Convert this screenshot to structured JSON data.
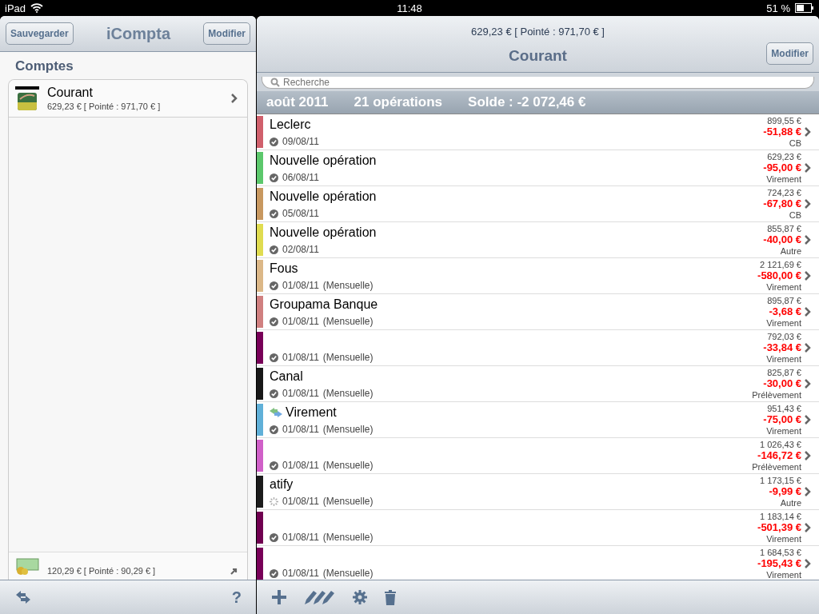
{
  "status_bar": {
    "device": "iPad",
    "time": "11:48",
    "battery": "51 %"
  },
  "left": {
    "save_button": "Sauvegarder",
    "title": "iCompta",
    "edit_button": "Modifier",
    "section": "Comptes",
    "accounts": [
      {
        "name": "Courant",
        "balance": "629,23 € [ Pointé : 971,70 € ]",
        "kind": "bank"
      },
      {
        "balance": "120,29 € [ Pointé : 90,29 € ]",
        "kind": "cash"
      }
    ],
    "help": "?"
  },
  "right": {
    "subtitle": "629,23 € [ Pointé : 971,70 € ]",
    "title": "Courant",
    "edit_button": "Modifier",
    "search": {
      "placeholder": "Recherche"
    },
    "summary": {
      "month": "août 2011",
      "count": "21 opérations",
      "balance": "Solde : -2 072,46 €"
    },
    "operations": [
      {
        "name": "Leclerc",
        "date": "09/08/11",
        "cleared": true,
        "running": "899,55 €",
        "amount": "-51,88 €",
        "type": "CB",
        "color": "#d0606c"
      },
      {
        "name": "Nouvelle opération",
        "date": "06/08/11",
        "cleared": true,
        "running": "629,23 €",
        "amount": "-95,00 €",
        "type": "Virement",
        "color": "#5cc86c"
      },
      {
        "name": "Nouvelle opération",
        "date": "05/08/11",
        "cleared": true,
        "running": "724,23 €",
        "amount": "-67,80 €",
        "type": "CB",
        "color": "#c89860"
      },
      {
        "name": "Nouvelle opération",
        "date": "02/08/11",
        "cleared": true,
        "running": "855,87 €",
        "amount": "-40,00 €",
        "type": "Autre",
        "color": "#e0dc50"
      },
      {
        "name": "Fous",
        "date": "01/08/11",
        "recurrence": "(Mensuelle)",
        "cleared": true,
        "running": "2 121,69 €",
        "amount": "-580,00 €",
        "type": "Virement",
        "color": "#dcb888"
      },
      {
        "name": "Groupama Banque",
        "date": "01/08/11",
        "recurrence": "(Mensuelle)",
        "cleared": true,
        "running": "895,87 €",
        "amount": "-3,68 €",
        "type": "Virement",
        "color": "#d08080"
      },
      {
        "date": "01/08/11",
        "recurrence": "(Mensuelle)",
        "cleared": true,
        "running": "792,03 €",
        "amount": "-33,84 €",
        "type": "Virement",
        "color": "#780058"
      },
      {
        "name": "Canal",
        "date": "01/08/11",
        "recurrence": "(Mensuelle)",
        "cleared": true,
        "running": "825,87 €",
        "amount": "-30,00 €",
        "type": "Prélèvement",
        "color": "#181818"
      },
      {
        "name": "Virement",
        "transfer": true,
        "date": "01/08/11",
        "recurrence": "(Mensuelle)",
        "cleared": true,
        "running": "951,43 €",
        "amount": "-75,00 €",
        "type": "Virement",
        "color": "#60b0d8"
      },
      {
        "date": "01/08/11",
        "recurrence": "(Mensuelle)",
        "cleared": true,
        "running": "1 026,43 €",
        "amount": "-146,72 €",
        "type": "Prélèvement",
        "color": "#d060c8"
      },
      {
        "name": "atify",
        "date": "01/08/11",
        "recurrence": "(Mensuelle)",
        "cleared": false,
        "running": "1 173,15 €",
        "amount": "-9,99 €",
        "type": "Autre",
        "color": "#1c1c1c"
      },
      {
        "date": "01/08/11",
        "recurrence": "(Mensuelle)",
        "cleared": true,
        "running": "1 183,14 €",
        "amount": "-501,39 €",
        "type": "Virement",
        "color": "#700050"
      },
      {
        "date": "01/08/11",
        "recurrence": "(Mensuelle)",
        "cleared": true,
        "running": "1 684,53 €",
        "amount": "-195,43 €",
        "type": "Virement",
        "color": "#780058"
      }
    ]
  }
}
